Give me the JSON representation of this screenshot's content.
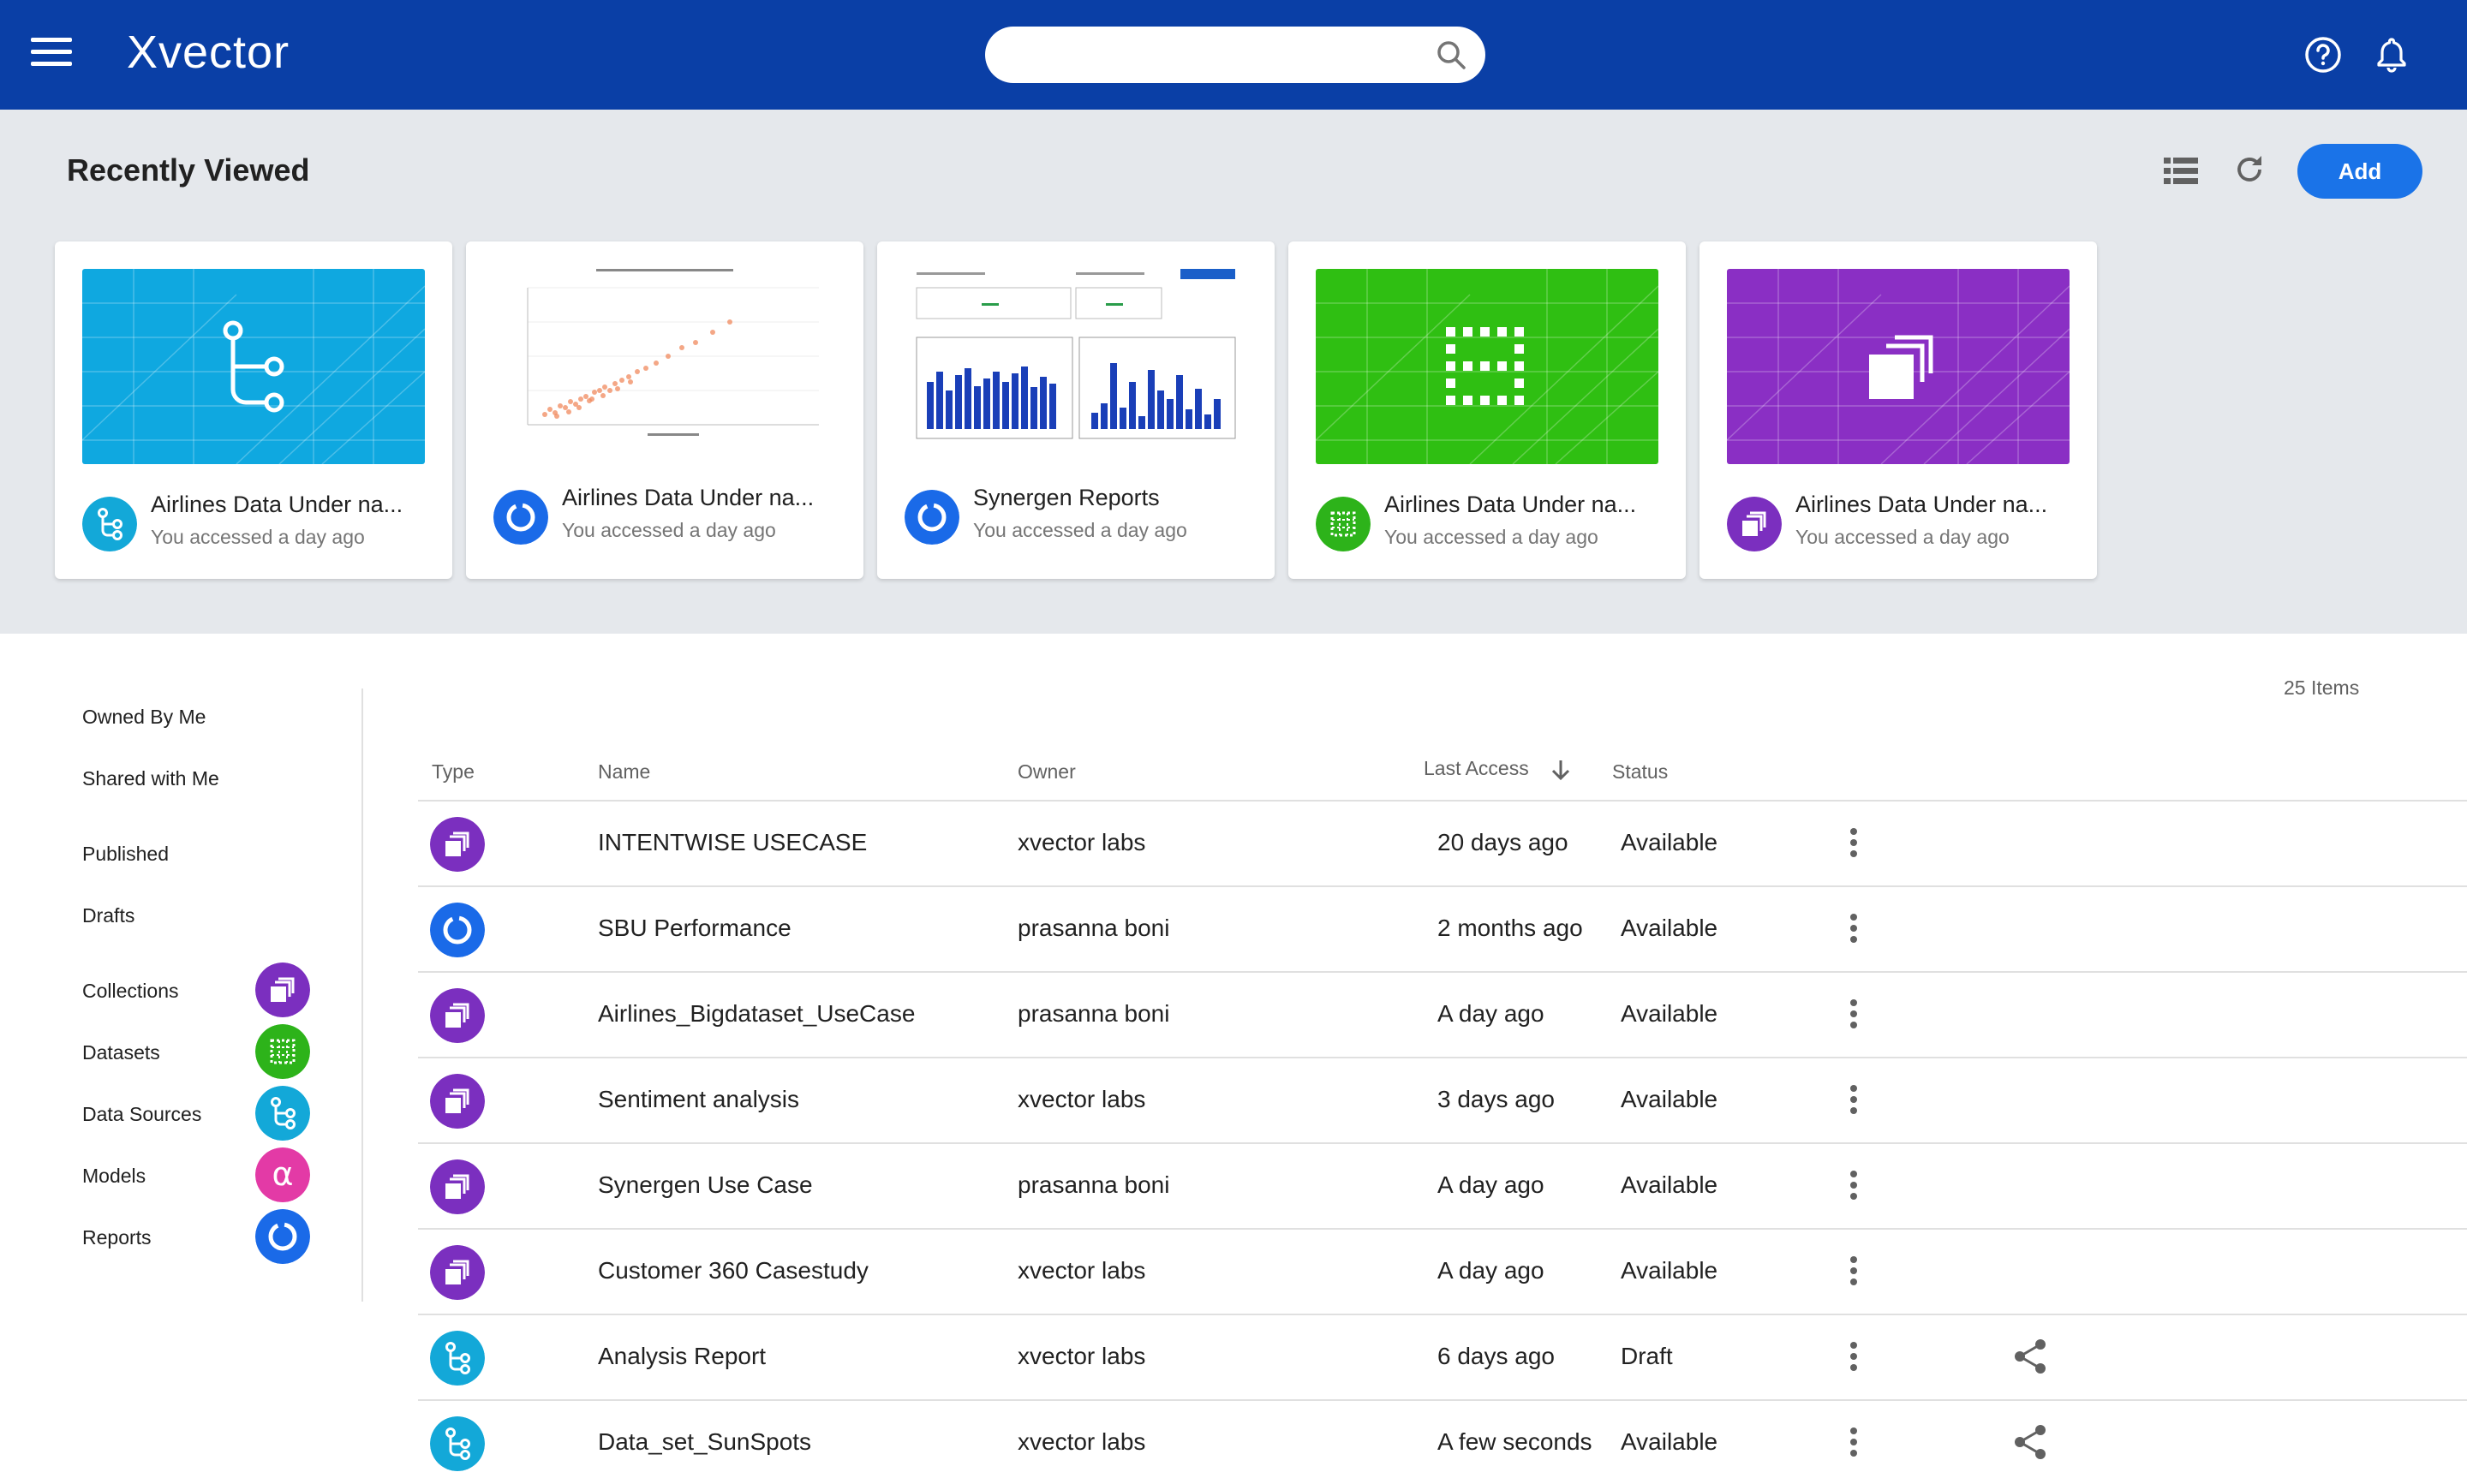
{
  "app": {
    "logo_text": "Xvector"
  },
  "header": {
    "search": {
      "placeholder": "",
      "value": ""
    },
    "icons": [
      "menu-icon",
      "search-icon",
      "help-icon",
      "bell-icon"
    ]
  },
  "recently_viewed": {
    "title": "Recently Viewed",
    "add_label": "Add",
    "cards": [
      {
        "title": "Airlines Data Under na...",
        "subtitle": "You accessed a day ago",
        "type": "data-source",
        "color": "#13a8d8"
      },
      {
        "title": "Airlines Data Under na...",
        "subtitle": "You accessed a day ago",
        "type": "report",
        "color": "#1a6ae8"
      },
      {
        "title": "Synergen Reports",
        "subtitle": "You accessed a day ago",
        "type": "report",
        "color": "#1a6ae8"
      },
      {
        "title": "Airlines Data Under na...",
        "subtitle": "You accessed a day ago",
        "type": "dataset",
        "color": "#2db31a"
      },
      {
        "title": "Airlines Data Under na...",
        "subtitle": "You accessed a day ago",
        "type": "collection",
        "color": "#7b2fbf"
      }
    ]
  },
  "sidebar": {
    "items": [
      {
        "label": "Owned By Me"
      },
      {
        "label": "Shared with Me"
      },
      {
        "label": "Published"
      },
      {
        "label": "Drafts"
      },
      {
        "label": "Collections",
        "icon": "collection-icon",
        "color": "#7b2fbf"
      },
      {
        "label": "Datasets",
        "icon": "dataset-icon",
        "color": "#2db31a"
      },
      {
        "label": "Data Sources",
        "icon": "data-source-icon",
        "color": "#13a8d8"
      },
      {
        "label": "Models",
        "icon": "model-alpha-icon",
        "color": "#e33aa6"
      },
      {
        "label": "Reports",
        "icon": "report-icon",
        "color": "#1a6ae8"
      }
    ]
  },
  "table": {
    "items_count": "25 Items",
    "columns": {
      "type": "Type",
      "name": "Name",
      "owner": "Owner",
      "last_access": "Last Access",
      "status": "Status"
    },
    "sort": {
      "column": "last_access",
      "direction": "desc"
    },
    "rows": [
      {
        "type": "collection",
        "name": "INTENTWISE USECASE",
        "owner": "xvector labs",
        "last_access": "20 days ago",
        "status": "Available",
        "share": false
      },
      {
        "type": "report",
        "name": "SBU Performance",
        "owner": "prasanna boni",
        "last_access": "2 months ago",
        "status": "Available",
        "share": false
      },
      {
        "type": "collection",
        "name": "Airlines_Bigdataset_UseCase",
        "owner": "prasanna boni",
        "last_access": "A day ago",
        "status": "Available",
        "share": false
      },
      {
        "type": "collection",
        "name": "Sentiment analysis",
        "owner": "xvector labs",
        "last_access": "3 days ago",
        "status": "Available",
        "share": false
      },
      {
        "type": "collection",
        "name": "Synergen Use Case",
        "owner": "prasanna boni",
        "last_access": "A day ago",
        "status": "Available",
        "share": false
      },
      {
        "type": "collection",
        "name": "Customer 360 Casestudy",
        "owner": "xvector labs",
        "last_access": "A day ago",
        "status": "Available",
        "share": false
      },
      {
        "type": "data-source",
        "name": "Analysis Report",
        "owner": "xvector labs",
        "last_access": "6 days ago",
        "status": "Draft",
        "share": true
      },
      {
        "type": "data-source",
        "name": "Data_set_SunSpots",
        "owner": "xvector labs",
        "last_access": "A few seconds",
        "status": "Available",
        "share": true
      }
    ]
  }
}
